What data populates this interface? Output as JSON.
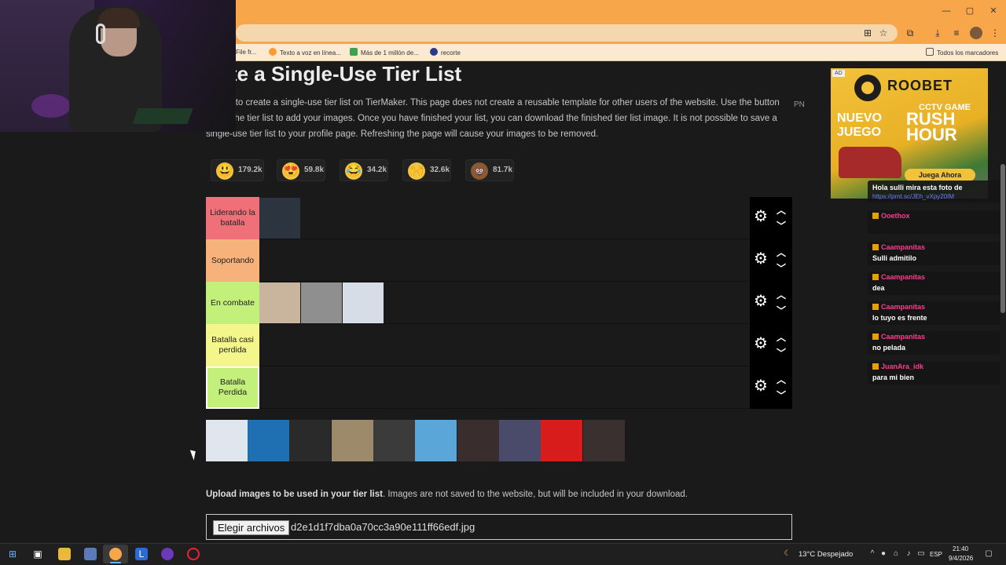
{
  "browser": {
    "window_controls": [
      "—",
      "▢",
      "✕"
    ],
    "bookmarks": [
      {
        "label": "File fr...",
        "color": "#2b6fd6"
      },
      {
        "label": "Texto a voz en línea...",
        "color": "#ff9a2e"
      },
      {
        "label": "Más de 1 millón de...",
        "color": "#3fa34d"
      },
      {
        "label": "recorte",
        "color": "#2a3a8a"
      }
    ],
    "all_bookmarks_label": "Todos los marcadores"
  },
  "page": {
    "title": "eate a Single-Use Tier List",
    "intro": "s page to create a single-use tier list on TierMaker. This page does not create a reusable template for other users of the website. Use the button below the tier list to add your images. Once you have finished your list, you can download the finished tier list image. It is not possible to save a single-use tier list to your profile page. Refreshing the page will cause your images to be removed.",
    "pn_label": "PN",
    "reactions": [
      {
        "emoji": "😃",
        "count": "179.2k",
        "bg": "#f4c542"
      },
      {
        "emoji": "😍",
        "count": "59.8k",
        "bg": "#f4c542"
      },
      {
        "emoji": "😂",
        "count": "34.2k",
        "bg": "#f4c542"
      },
      {
        "emoji": "🙌",
        "count": "32.6k",
        "bg": "#f4c542"
      },
      {
        "emoji": "💩",
        "count": "81.7k",
        "bg": "#8a5a2e"
      }
    ],
    "tiers": [
      {
        "label": "Liderando la batalla",
        "color": "#f0707a",
        "items": [
          "#2c3440"
        ]
      },
      {
        "label": "Soportando",
        "color": "#f6b27a",
        "items": []
      },
      {
        "label": "En combate",
        "color": "#c3f07a",
        "items": [
          "#c9b59e",
          "#8f8f8f",
          "#d7dde6"
        ]
      },
      {
        "label": "Batalla casi perdida",
        "color": "#f4f58a",
        "items": []
      },
      {
        "label": "Batalla Perdida",
        "color": "#c3f07a",
        "items": []
      }
    ],
    "gear_glyph": "⚙",
    "up_glyph": "︿",
    "down_glyph": "﹀",
    "pool_items": [
      "#dfe6ee",
      "#1f6fb3",
      "#2a2a2a",
      "#9c8a6a",
      "#3b3b3b",
      "#5aa6d8",
      "#3a2d2d",
      "#4a4a6a",
      "#d81c1c",
      "#3a3030"
    ],
    "upload_bold": "Upload images to be used in your tier list",
    "upload_rest": ". Images are not saved to the website, but will be included in your download.",
    "file_button": "Elegir archivos",
    "file_name": "d2e1d1f7dba0a70cc3a90e111ff66edf.jpg"
  },
  "ad": {
    "tag": "AD",
    "brand": "ROOBET",
    "cctv": "CCTV GAME",
    "rush": "RUSH HOUR",
    "nuevo": "NUEVO JUEGO",
    "cta": "Juega Ahora"
  },
  "chat": [
    {
      "type": "msg",
      "text": "Hola sulli mira esta foto de"
    },
    {
      "type": "link",
      "text": "https://prnt.sc/JEh_vXpy20IM"
    },
    {
      "type": "user",
      "text": "Ooethox"
    },
    {
      "type": "user",
      "text": "Caampanitas"
    },
    {
      "type": "msg",
      "text": "Sulli admitilo"
    },
    {
      "type": "user",
      "text": "Caampanitas"
    },
    {
      "type": "msg",
      "text": "dea"
    },
    {
      "type": "user",
      "text": "Caampanitas"
    },
    {
      "type": "msg",
      "text": "lo tuyo es frente"
    },
    {
      "type": "user",
      "text": "Caampanitas"
    },
    {
      "type": "msg",
      "text": "no pelada"
    },
    {
      "type": "user",
      "text": "JuanAra_idk"
    },
    {
      "type": "msg",
      "text": "para mi bien"
    }
  ],
  "taskbar": {
    "weather": "13°C  Despejado",
    "lang": "ESP",
    "time": "21:40",
    "date": "9/4/2026"
  }
}
